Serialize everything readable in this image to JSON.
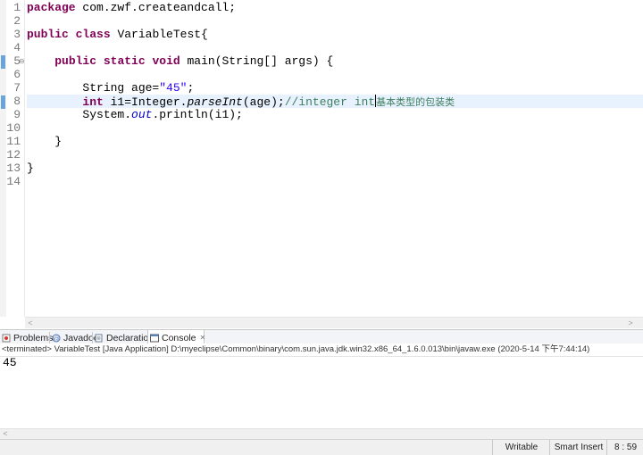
{
  "editor": {
    "line_numbers": [
      "1",
      "2",
      "3",
      "4",
      "5",
      "6",
      "7",
      "8",
      "9",
      "10",
      "11",
      "12",
      "13",
      "14"
    ],
    "lines": {
      "l1": {
        "kw": "package",
        "rest": " com.zwf.createandcall;"
      },
      "l3": {
        "kw1": "public",
        "kw2": "class",
        "rest": " VariableTest{"
      },
      "l5": {
        "kw1": "public",
        "kw2": "static",
        "kw3": "void",
        "rest": " main(String[] args) {"
      },
      "l7": {
        "pre": "String age=",
        "str": "\"45\"",
        "post": ";"
      },
      "l8": {
        "kw": "int",
        "a": " i1=Integer.",
        "method": "parseInt",
        "b": "(age);",
        "comment": "//integer int",
        "comment_cjk": "基本类型的包装类"
      },
      "l9": {
        "a": "System.",
        "field": "out",
        "b": ".println(i1);"
      },
      "l11": {
        "text": "}"
      },
      "l13": {
        "text": "}"
      }
    },
    "current_line": 8,
    "modified_lines": [
      5,
      8
    ]
  },
  "console_view": {
    "tabs": [
      {
        "label": "Problems",
        "icon": "problems-icon"
      },
      {
        "label": "Javadoc",
        "icon": "javadoc-icon"
      },
      {
        "label": "Declaration",
        "icon": "declaration-icon"
      },
      {
        "label": "Console",
        "icon": "console-icon",
        "active": true,
        "close": "✕"
      }
    ],
    "status": "<terminated> VariableTest [Java Application] D:\\myeclipse\\Common\\binary\\com.sun.java.jdk.win32.x86_64_1.6.0.013\\bin\\javaw.exe (2020-5-14 下午7:44:14)",
    "output": "45"
  },
  "statusbar": {
    "writable": "Writable",
    "insert_mode": "Smart Insert",
    "position": "8 : 59"
  },
  "colors": {
    "keyword": "#7f0055",
    "string": "#2a00ff",
    "comment": "#3f7f5f",
    "field": "#0000c0",
    "current_line_bg": "#e8f2fe"
  }
}
